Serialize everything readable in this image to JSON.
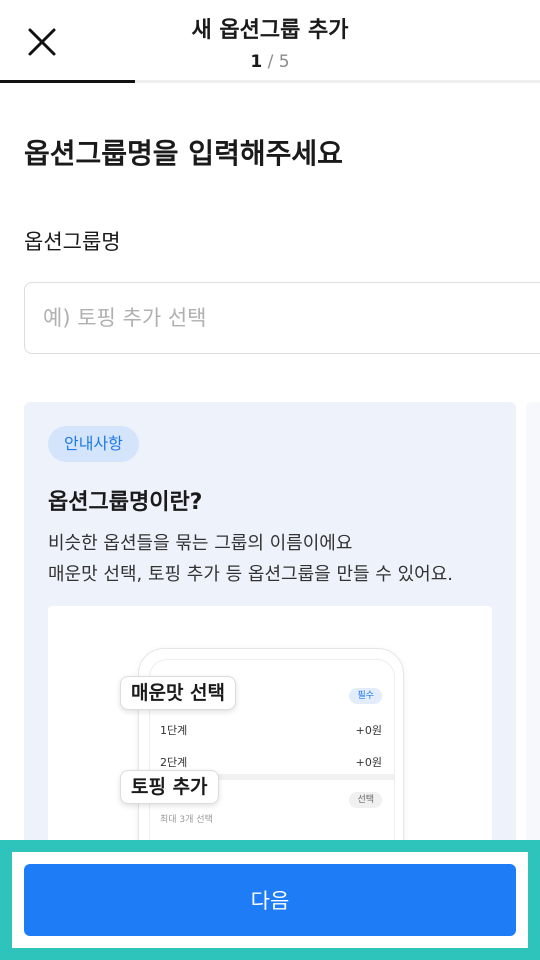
{
  "header": {
    "title": "새 옵션그룹 추가",
    "step_current": "1",
    "step_separator": "/",
    "step_total": "5",
    "progress_fraction": 0.25
  },
  "main": {
    "heading": "옵션그룹명을 입력해주세요",
    "field_label": "옵션그룹명",
    "input_value": "",
    "input_placeholder": "예) 토핑 추가 선택"
  },
  "info_card": {
    "badge": "안내사항",
    "title": "옵션그룹명이란?",
    "desc_line1": "비슷한 옵션들을 묶는 그룹의 이름이에요",
    "desc_line2": "매운맛 선택, 토핑 추가 등 옵션그룹을 만들 수 있어요.",
    "illustration": {
      "callout_spicy": "매운맛 선택",
      "callout_topping": "토핑 추가",
      "required_pill": "필수",
      "optional_pill": "선택",
      "row1_label": "1단계",
      "row1_price": "+0원",
      "row2_label": "2단계",
      "row2_price": "+0원",
      "max_select": "최대 3개 선택"
    }
  },
  "footer": {
    "next_label": "다음"
  },
  "colors": {
    "accent": "#1f7cf7",
    "badge_bg": "#d4e5fb",
    "card_bg": "#eef3fb",
    "highlight_frame": "#2ec4bb"
  },
  "icons": {
    "close": "close-icon"
  }
}
